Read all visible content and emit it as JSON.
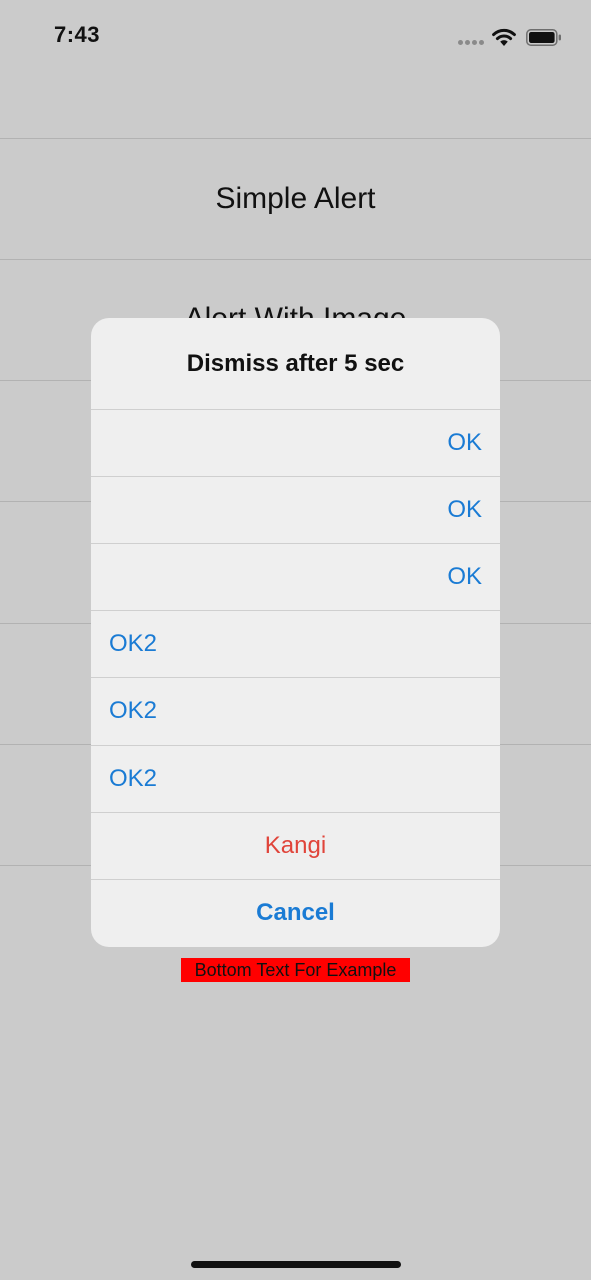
{
  "status_bar": {
    "time": "7:43"
  },
  "background": {
    "rows": [
      "Simple Alert",
      "Alert With Image"
    ]
  },
  "alert": {
    "title": "Dismiss after 5 sec",
    "actions": [
      {
        "label": "OK",
        "align": "right",
        "style": "default"
      },
      {
        "label": "OK",
        "align": "right",
        "style": "default"
      },
      {
        "label": "OK",
        "align": "right",
        "style": "default"
      },
      {
        "label": "OK2",
        "align": "left",
        "style": "default"
      },
      {
        "label": "OK2",
        "align": "left",
        "style": "default"
      },
      {
        "label": "OK2",
        "align": "left",
        "style": "default"
      },
      {
        "label": "Kangi",
        "align": "center",
        "style": "destructive"
      },
      {
        "label": "Cancel",
        "align": "center",
        "style": "cancel"
      }
    ]
  },
  "bottom_text": "Bottom Text For Example",
  "colors": {
    "action_blue": "#1a7bd4",
    "destructive_red": "#e0443a",
    "highlight_red": "#ff0000",
    "dim_background": "#cbcbcb",
    "alert_background": "#efefef"
  }
}
